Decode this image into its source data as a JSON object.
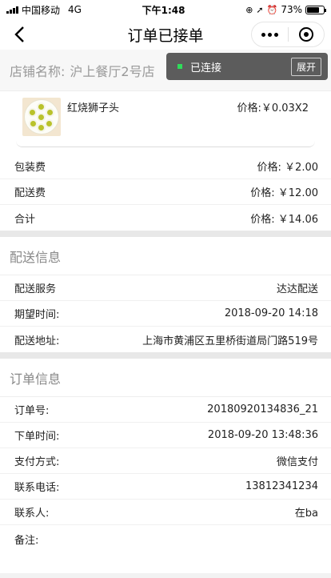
{
  "status_bar": {
    "carrier": "中国移动",
    "network": "4G",
    "time": "下午1:48",
    "battery": "73%",
    "battery_level": 0.73
  },
  "nav": {
    "title": "订单已接单"
  },
  "shop": {
    "label": "店铺名称:",
    "name": "沪上餐厅2号店"
  },
  "toast": {
    "text": "已连接",
    "button": "展开"
  },
  "item": {
    "name": "红烧狮子头",
    "price": "价格:￥0.03X2"
  },
  "fees": [
    {
      "label": "包装费",
      "value": "价格: ￥2.00"
    },
    {
      "label": "配送费",
      "value": "价格: ￥12.00"
    },
    {
      "label": "合计",
      "value": "价格: ￥14.06"
    }
  ],
  "delivery": {
    "title": "配送信息",
    "rows": [
      {
        "label": "配送服务",
        "value": "达达配送"
      },
      {
        "label": "期望时间:",
        "value": "2018-09-20 14:18"
      },
      {
        "label": "配送地址:",
        "value": "上海市黄浦区五里桥街道局门路519号"
      }
    ]
  },
  "order": {
    "title": "订单信息",
    "rows": [
      {
        "label": "订单号:",
        "value": "20180920134836_21"
      },
      {
        "label": "下单时间:",
        "value": "2018-09-20 13:48:36"
      },
      {
        "label": "支付方式:",
        "value": "微信支付"
      },
      {
        "label": "联系电话:",
        "value": "13812341234"
      },
      {
        "label": "联系人:",
        "value": "在ba"
      },
      {
        "label": "备注:",
        "value": ""
      }
    ]
  }
}
